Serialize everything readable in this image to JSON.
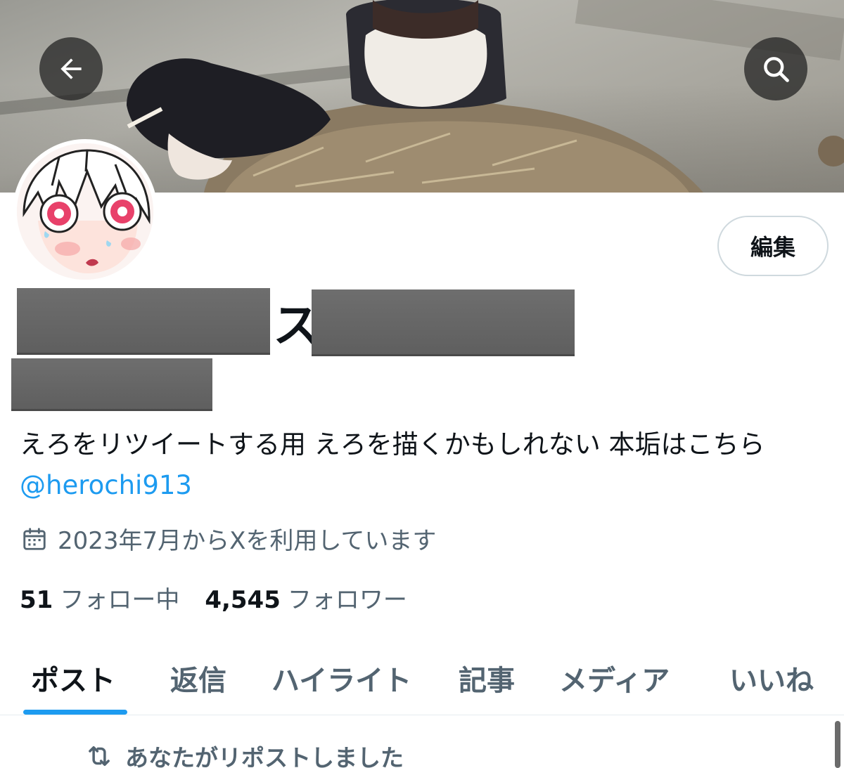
{
  "header": {
    "back_icon": "arrow-left-icon",
    "search_icon": "search-icon"
  },
  "profile": {
    "name_visible_fragment": "ス",
    "edit_button_label": "編集",
    "bio_text": "えろをリツイートする用 えろを描くかもしれない 本垢はこちら ",
    "bio_mention": "@herochi913",
    "joined_text": "2023年7月からXを利用しています",
    "following_count": "51",
    "following_label": "フォロー中",
    "followers_count": "4,545",
    "followers_label": "フォロワー"
  },
  "tabs": [
    {
      "label": "ポスト",
      "active": true
    },
    {
      "label": "返信",
      "active": false
    },
    {
      "label": "ハイライト",
      "active": false
    },
    {
      "label": "記事",
      "active": false
    },
    {
      "label": "メディア",
      "active": false
    },
    {
      "label": "いいね",
      "active": false
    }
  ],
  "feed": {
    "repost_notice": "あなたがリポストしました"
  },
  "colors": {
    "accent": "#1d9bf0",
    "text_primary": "#0f1419",
    "text_secondary": "#536471"
  }
}
